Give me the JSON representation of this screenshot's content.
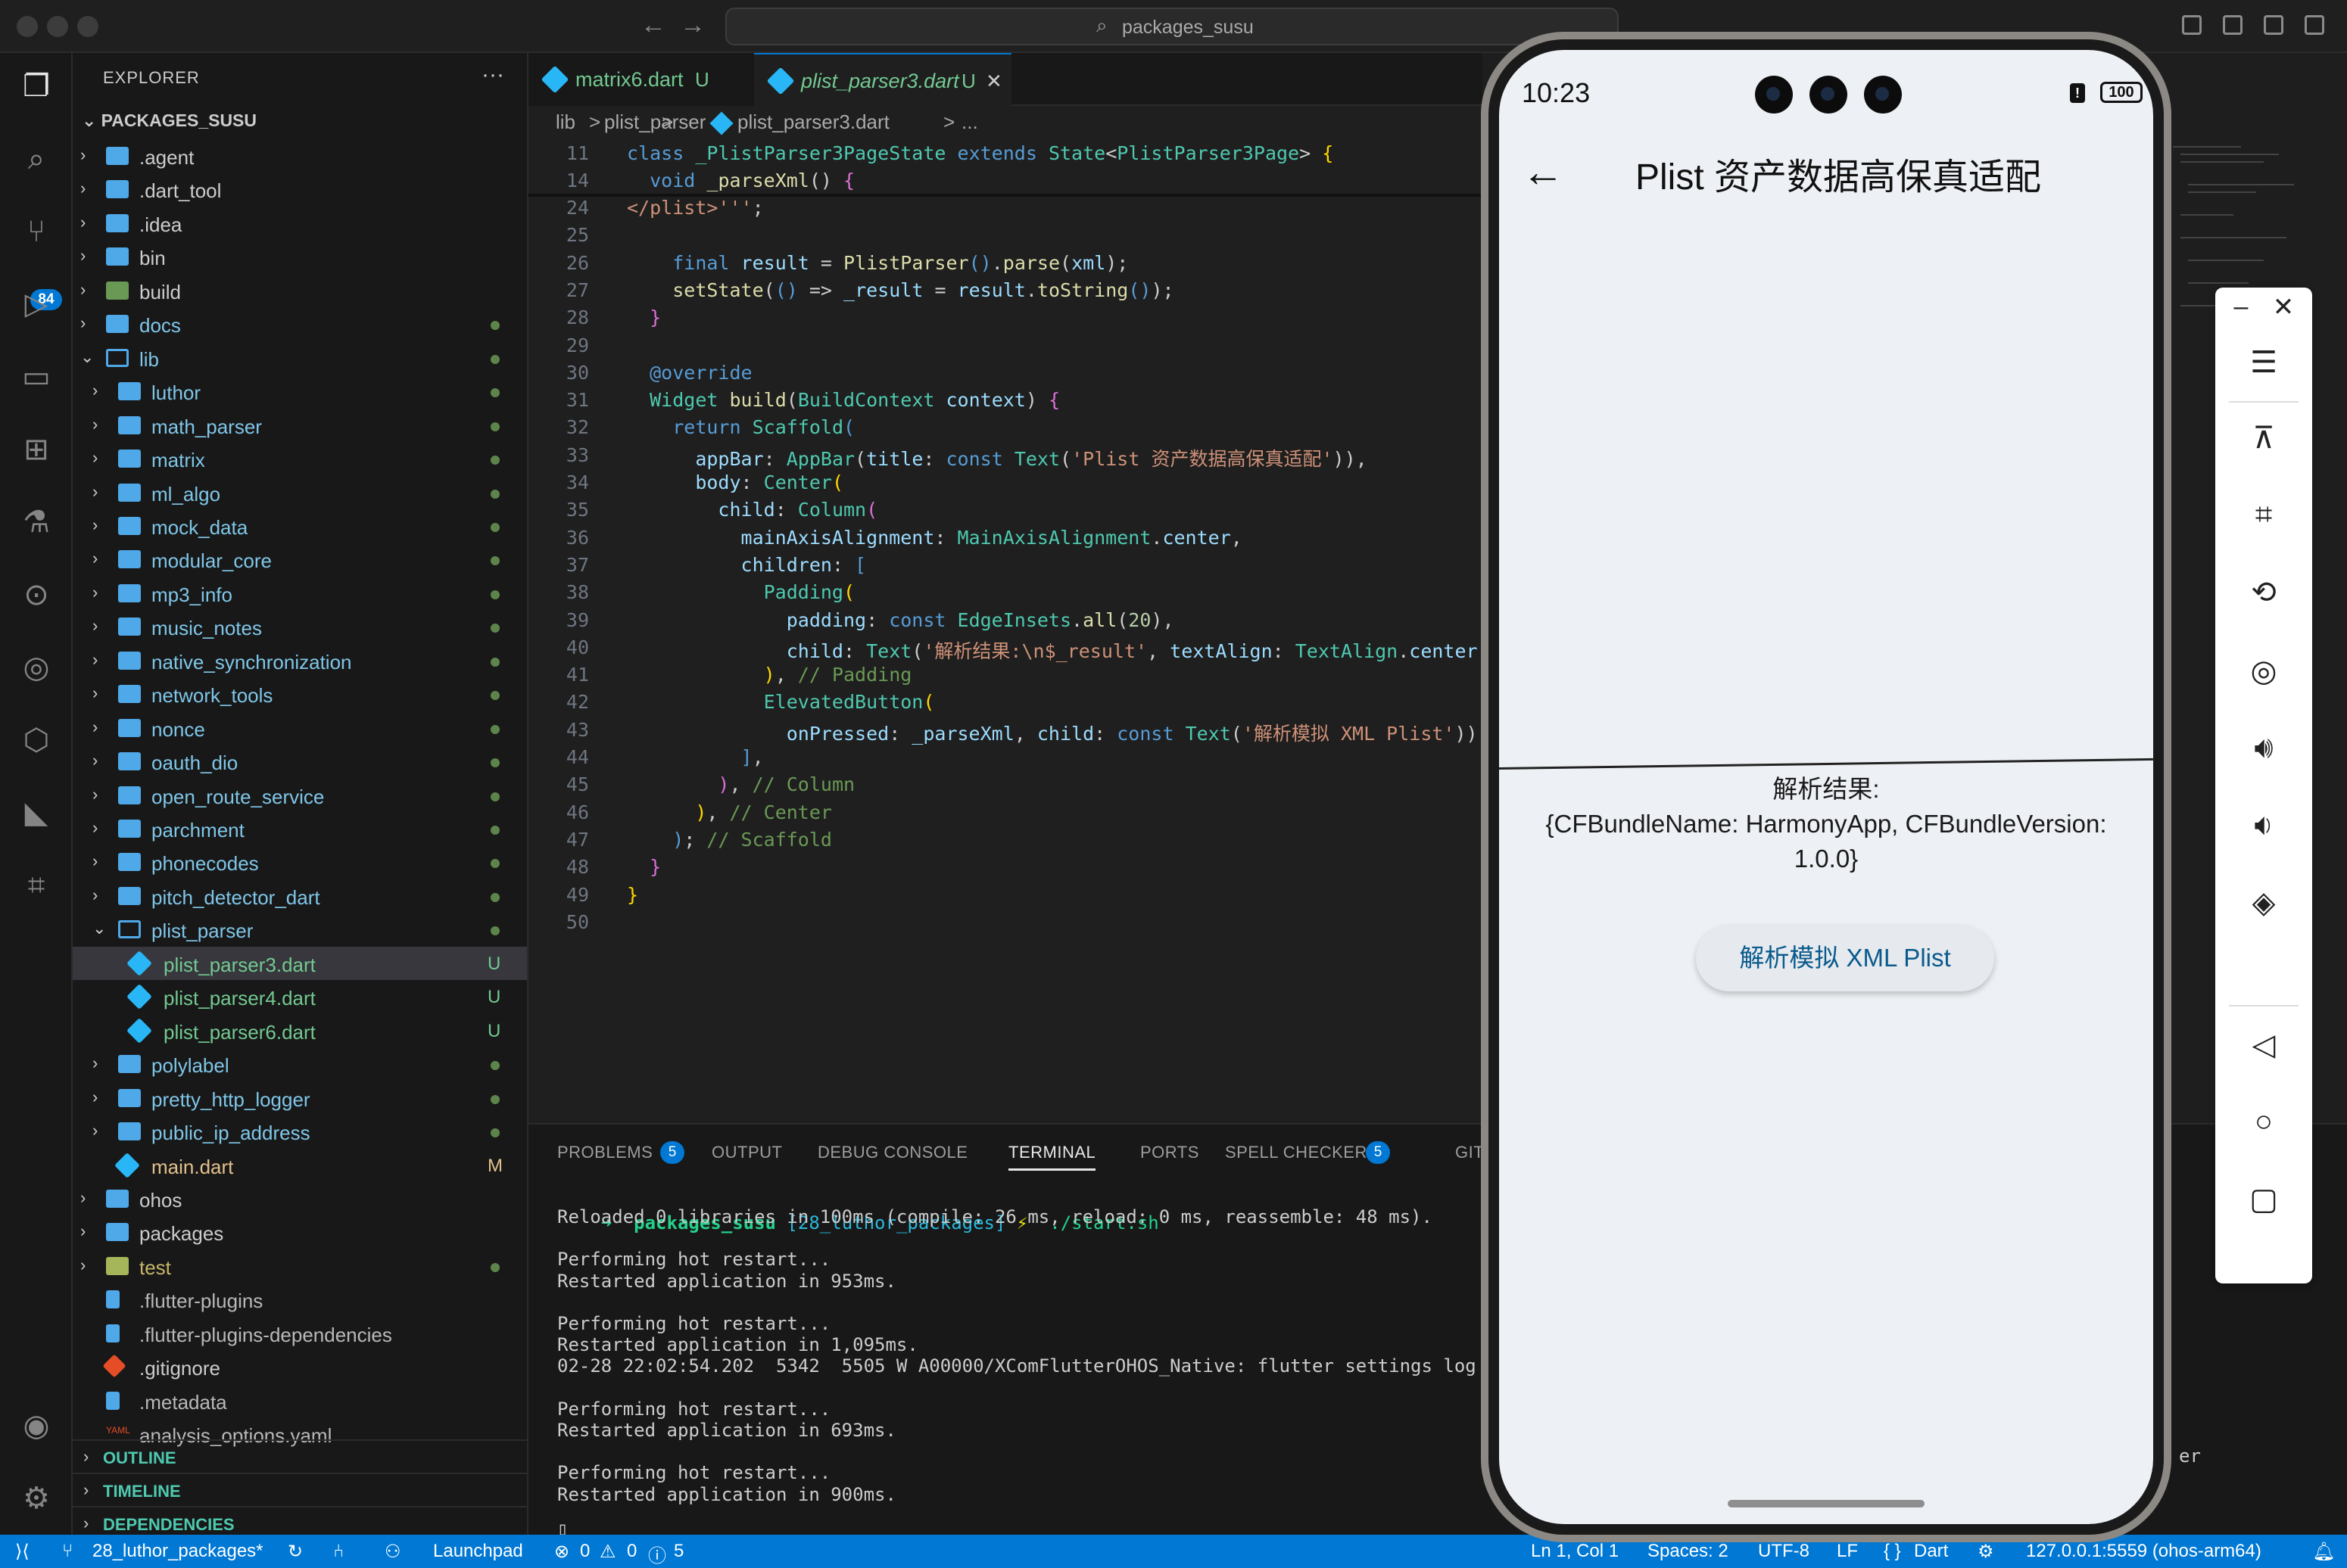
{
  "window": {
    "search": "packages_susu"
  },
  "activity": {
    "scm_badge": "84"
  },
  "explorer": {
    "header": "EXPLORER",
    "more": "···",
    "root": "PACKAGES_SUSU",
    "items": [
      {
        "name": ".agent",
        "kind": "folder",
        "depth": 0,
        "open": false,
        "mark": ""
      },
      {
        "name": ".dart_tool",
        "kind": "folder",
        "depth": 0,
        "open": false,
        "mark": ""
      },
      {
        "name": ".idea",
        "kind": "folder",
        "depth": 0,
        "open": false,
        "mark": ""
      },
      {
        "name": "bin",
        "kind": "folder",
        "depth": 0,
        "open": false,
        "mark": ""
      },
      {
        "name": "build",
        "kind": "folder",
        "depth": 0,
        "open": false,
        "mark": ""
      },
      {
        "name": "docs",
        "kind": "folder",
        "depth": 0,
        "open": false,
        "mark": "dot"
      },
      {
        "name": "lib",
        "kind": "folder",
        "depth": 0,
        "open": true,
        "mark": "dot"
      },
      {
        "name": "luthor",
        "kind": "folder",
        "depth": 1,
        "open": false,
        "mark": "dot"
      },
      {
        "name": "math_parser",
        "kind": "folder",
        "depth": 1,
        "open": false,
        "mark": "dot"
      },
      {
        "name": "matrix",
        "kind": "folder",
        "depth": 1,
        "open": false,
        "mark": "dot"
      },
      {
        "name": "ml_algo",
        "kind": "folder",
        "depth": 1,
        "open": false,
        "mark": "dot"
      },
      {
        "name": "mock_data",
        "kind": "folder",
        "depth": 1,
        "open": false,
        "mark": "dot"
      },
      {
        "name": "modular_core",
        "kind": "folder",
        "depth": 1,
        "open": false,
        "mark": "dot"
      },
      {
        "name": "mp3_info",
        "kind": "folder",
        "depth": 1,
        "open": false,
        "mark": "dot"
      },
      {
        "name": "music_notes",
        "kind": "folder",
        "depth": 1,
        "open": false,
        "mark": "dot"
      },
      {
        "name": "native_synchronization",
        "kind": "folder",
        "depth": 1,
        "open": false,
        "mark": "dot"
      },
      {
        "name": "network_tools",
        "kind": "folder",
        "depth": 1,
        "open": false,
        "mark": "dot"
      },
      {
        "name": "nonce",
        "kind": "folder",
        "depth": 1,
        "open": false,
        "mark": "dot"
      },
      {
        "name": "oauth_dio",
        "kind": "folder",
        "depth": 1,
        "open": false,
        "mark": "dot"
      },
      {
        "name": "open_route_service",
        "kind": "folder",
        "depth": 1,
        "open": false,
        "mark": "dot"
      },
      {
        "name": "parchment",
        "kind": "folder",
        "depth": 1,
        "open": false,
        "mark": "dot"
      },
      {
        "name": "phonecodes",
        "kind": "folder",
        "depth": 1,
        "open": false,
        "mark": "dot"
      },
      {
        "name": "pitch_detector_dart",
        "kind": "folder",
        "depth": 1,
        "open": false,
        "mark": "dot"
      },
      {
        "name": "plist_parser",
        "kind": "folder",
        "depth": 1,
        "open": true,
        "mark": "dot"
      },
      {
        "name": "plist_parser3.dart",
        "kind": "dart",
        "depth": 2,
        "open": false,
        "mark": "U",
        "selected": true
      },
      {
        "name": "plist_parser4.dart",
        "kind": "dart",
        "depth": 2,
        "open": false,
        "mark": "U"
      },
      {
        "name": "plist_parser6.dart",
        "kind": "dart",
        "depth": 2,
        "open": false,
        "mark": "U"
      },
      {
        "name": "polylabel",
        "kind": "folder",
        "depth": 1,
        "open": false,
        "mark": "dot"
      },
      {
        "name": "pretty_http_logger",
        "kind": "folder",
        "depth": 1,
        "open": false,
        "mark": "dot"
      },
      {
        "name": "public_ip_address",
        "kind": "folder",
        "depth": 1,
        "open": false,
        "mark": "dot"
      },
      {
        "name": "main.dart",
        "kind": "dart",
        "depth": 1,
        "open": false,
        "mark": "M"
      },
      {
        "name": "ohos",
        "kind": "folder",
        "depth": 0,
        "open": false,
        "mark": ""
      },
      {
        "name": "packages",
        "kind": "folder",
        "depth": 0,
        "open": false,
        "mark": ""
      },
      {
        "name": "test",
        "kind": "folder",
        "depth": 0,
        "open": false,
        "mark": "dot"
      },
      {
        "name": ".flutter-plugins",
        "kind": "file",
        "depth": 0,
        "open": false,
        "mark": ""
      },
      {
        "name": ".flutter-plugins-dependencies",
        "kind": "file",
        "depth": 0,
        "open": false,
        "mark": ""
      },
      {
        "name": ".gitignore",
        "kind": "git",
        "depth": 0,
        "open": false,
        "mark": ""
      },
      {
        "name": ".metadata",
        "kind": "file",
        "depth": 0,
        "open": false,
        "mark": ""
      },
      {
        "name": "analysis_options.yaml",
        "kind": "yaml",
        "depth": 0,
        "open": false,
        "mark": ""
      }
    ],
    "sections": [
      "OUTLINE",
      "TIMELINE",
      "DEPENDENCIES"
    ]
  },
  "tabs": [
    {
      "label": "matrix6.dart",
      "status": "U",
      "active": false
    },
    {
      "label": "plist_parser3.dart",
      "status": "U",
      "active": true
    }
  ],
  "breadcrumb": [
    "lib",
    ">",
    "plist_parser",
    ">",
    "plist_parser3.dart",
    ">",
    "..."
  ],
  "code": [
    {
      "n": "11",
      "html": "<span class='k'>class</span> <span class='t'>_PlistParser3PageState</span> <span class='k'>extends</span> <span class='t'>State</span>&lt;<span class='t'>PlistParser3Page</span>&gt; <span class='y'>{</span>"
    },
    {
      "n": "14",
      "html": "  <span class='k'>void</span> <span class='f'>_parseXml</span>() <span class='p'>{</span>"
    },
    {
      "n": "24",
      "html": "<span class='s'>&lt;/plist&gt;'''</span>;"
    },
    {
      "n": "25",
      "html": ""
    },
    {
      "n": "26",
      "html": "    <span class='k'>final</span> <span class='v'>result</span> = <span class='f'>PlistParser</span><span class='k'>()</span>.<span class='f'>parse</span>(<span class='v'>xml</span>);"
    },
    {
      "n": "27",
      "html": "    <span class='f'>setState</span>(<span class='k'>()</span> =&gt; <span class='v'>_result</span> = <span class='v'>result</span>.<span class='f'>toString</span><span class='k'>()</span>);"
    },
    {
      "n": "28",
      "html": "  <span class='p'>}</span>"
    },
    {
      "n": "29",
      "html": ""
    },
    {
      "n": "30",
      "html": "  <span class='k'>@override</span>"
    },
    {
      "n": "31",
      "html": "  <span class='t'>Widget</span> <span class='f'>build</span>(<span class='t'>BuildContext</span> <span class='v'>context</span>) <span class='p'>{</span>"
    },
    {
      "n": "32",
      "html": "    <span class='k'>return</span> <span class='t'>Scaffold</span><span class='k'>(</span>"
    },
    {
      "n": "33",
      "html": "      <span class='v'>appBar</span>: <span class='t'>AppBar</span>(<span class='v'>title</span>: <span class='k'>const</span> <span class='t'>Text</span>(<span class='s'>'Plist 资产数据高保真适配'</span>)),"
    },
    {
      "n": "34",
      "html": "      <span class='v'>body</span>: <span class='t'>Center</span><span class='y'>(</span>"
    },
    {
      "n": "35",
      "html": "        <span class='v'>child</span>: <span class='t'>Column</span><span class='p'>(</span>"
    },
    {
      "n": "36",
      "html": "          <span class='v'>mainAxisAlignment</span>: <span class='t'>MainAxisAlignment</span>.<span class='v'>center</span>,"
    },
    {
      "n": "37",
      "html": "          <span class='v'>children</span>: <span class='k'>[</span>"
    },
    {
      "n": "38",
      "html": "            <span class='t'>Padding</span><span class='y'>(</span>"
    },
    {
      "n": "39",
      "html": "              <span class='v'>padding</span>: <span class='k'>const</span> <span class='t'>EdgeInsets</span>.<span class='f'>all</span>(<span class='n'>20</span>),"
    },
    {
      "n": "40",
      "html": "              <span class='v'>child</span>: <span class='t'>Text</span>(<span class='s'>'解析结果:\\n$_result'</span>, <span class='v'>textAlign</span>: <span class='t'>TextAlign</span>.<span class='v'>center</span>),"
    },
    {
      "n": "41",
      "html": "            <span class='y'>)</span>, <span class='cmt'>// Padding</span>"
    },
    {
      "n": "42",
      "html": "            <span class='t'>ElevatedButton</span><span class='y'>(</span>"
    },
    {
      "n": "43",
      "html": "              <span class='v'>onPressed</span>: <span class='v'>_parseXml</span>, <span class='v'>child</span>: <span class='k'>const</span> <span class='t'>Text</span>(<span class='s'>'解析模拟 XML Plist'</span>))"
    },
    {
      "n": "44",
      "html": "          <span class='k'>]</span>,"
    },
    {
      "n": "45",
      "html": "        <span class='p'>)</span>, <span class='cmt'>// Column</span>"
    },
    {
      "n": "46",
      "html": "      <span class='y'>)</span>, <span class='cmt'>// Center</span>"
    },
    {
      "n": "47",
      "html": "    <span class='k'>)</span>; <span class='cmt'>// Scaffold</span>"
    },
    {
      "n": "48",
      "html": "  <span class='p'>}</span>"
    },
    {
      "n": "49",
      "html": "<span class='y'>}</span>"
    },
    {
      "n": "50",
      "html": ""
    }
  ],
  "panel": {
    "tabs": [
      {
        "label": "PROBLEMS",
        "badge": "5"
      },
      {
        "label": "OUTPUT",
        "badge": ""
      },
      {
        "label": "DEBUG CONSOLE",
        "badge": ""
      },
      {
        "label": "TERMINAL",
        "badge": "",
        "active": true
      },
      {
        "label": "PORTS",
        "badge": ""
      },
      {
        "label": "SPELL CHECKER",
        "badge": "5"
      },
      {
        "label": "GITLENS",
        "badge": ""
      }
    ],
    "prompt": {
      "dir": "packages_susu",
      "branch": "[28_luthor_packages]",
      "sym": "⚡",
      "cmd": "./start.sh"
    },
    "lines": [
      "Reloaded 0 libraries in 100ms (compile: 26 ms, reload: 0 ms, reassemble: 48 ms).",
      "",
      "Performing hot restart...",
      "Restarted application in 953ms.",
      "",
      "Performing hot restart...",
      "Restarted application in 1,095ms.",
      "02-28 22:02:54.202  5342  5505 W A00000/XComFlutterOHOS_Native: flutter settings log me",
      "",
      "Performing hot restart...",
      "Restarted application in 693ms.",
      "",
      "Performing hot restart...",
      "Restarted application in 900ms."
    ],
    "overflow_tail": "er"
  },
  "status": {
    "branch": "28_luthor_packages*",
    "launchpad": "Launchpad",
    "errors": "0",
    "warnings": "0",
    "info": "5",
    "position": "Ln 1, Col 1",
    "spaces": "Spaces: 2",
    "encoding": "UTF-8",
    "eol": "LF",
    "lang": "Dart",
    "device": "127.0.0.1:5559 (ohos-arm64)"
  },
  "phone": {
    "time": "10:23",
    "battery": "100",
    "title": "Plist 资产数据高保真适配",
    "result_label": "解析结果:",
    "result_value": "{CFBundleName: HarmonyApp, CFBundleVersion: 1.0.0}",
    "button": "解析模拟 XML Plist"
  },
  "colors": {
    "accent": "#0078d4",
    "folder": "#4fa8e8",
    "untracked": "#73c991",
    "modified": "#e2c08d"
  }
}
